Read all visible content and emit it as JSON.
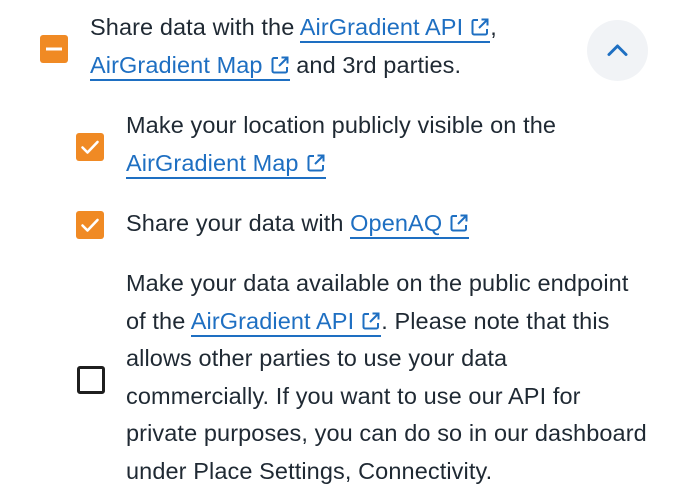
{
  "main_option": {
    "state": "indeterminate",
    "text_before": "Share data with the ",
    "link1": "AirGradient API",
    "comma": ",",
    "link2": "AirGradient Map",
    "text_after": " and 3rd parties."
  },
  "collapse_button": {
    "icon": "chevron-up-icon"
  },
  "options": [
    {
      "checked": true,
      "line1": "Make your location publicly visible on the",
      "link": "AirGradient Map"
    },
    {
      "checked": true,
      "text_before": "Share your data with ",
      "link": "OpenAQ"
    },
    {
      "checked": false,
      "line1": "Make your data available on the public endpoint",
      "line2_before": "of the ",
      "link": "AirGradient API",
      "line2_after": ". Please note that this",
      "line3": "allows other parties to use your data",
      "line4": "commercially. If you want to use our API for",
      "line5": "private purposes, you can do so in our dashboard",
      "line6": "under Place Settings, Connectivity."
    }
  ],
  "colors": {
    "accent": "#f08a24",
    "link": "#1e6fc2",
    "text": "#1f2933",
    "button_bg": "#f1f3f6"
  }
}
